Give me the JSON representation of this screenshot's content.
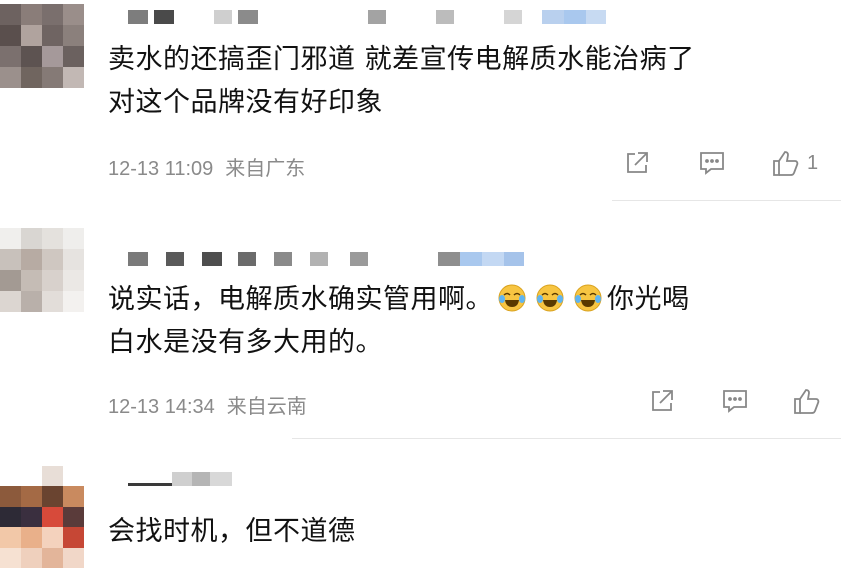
{
  "comments": [
    {
      "text_line1": "卖水的还搞歪门邪道 就差宣传电解质水能治病了",
      "text_line2": "对这个品牌没有好印象",
      "time": "12-13 11:09",
      "location": "来自广东",
      "like_count": "1"
    },
    {
      "text_part1": "说实话，电解质水确实管用啊。",
      "text_part2": "你光喝",
      "text_line2": "白水是没有多大用的。",
      "time": "12-13 14:34",
      "location": "来自云南",
      "emojis": [
        "laughing-crying-emoji",
        "laughing-crying-emoji",
        "laughing-crying-emoji"
      ]
    },
    {
      "text_line1": "会找时机，但不道德"
    }
  ],
  "icons": {
    "share": "share-icon",
    "comment": "comment-icon",
    "like": "thumbs-up-icon"
  },
  "colors": {
    "text": "#111111",
    "meta": "#8a8a8a",
    "divider": "#e6e6e6",
    "username_blur_blue": "#a9c8ee"
  }
}
